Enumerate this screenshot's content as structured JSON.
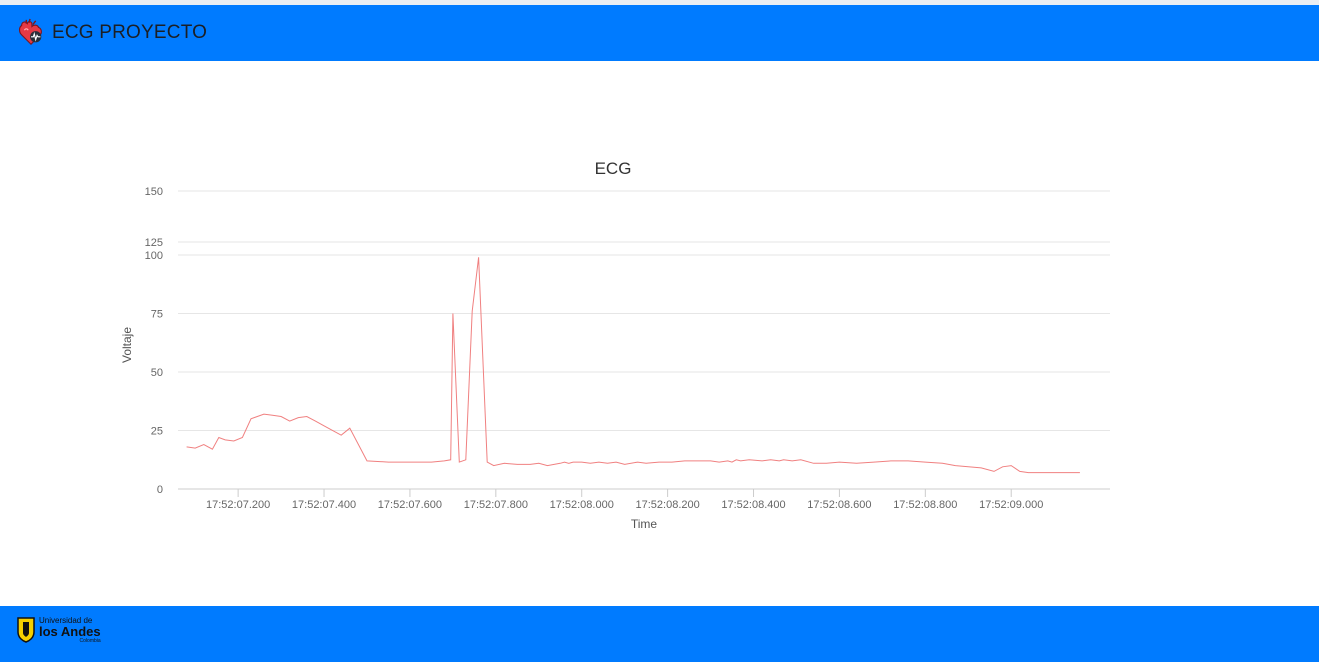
{
  "header": {
    "title": "ECG PROYECTO",
    "brand_icon": "heart-icon",
    "bar_color": "#007bff"
  },
  "footer": {
    "logo": {
      "line1": "Universidad de",
      "line2": "los Andes",
      "line3": "Colombia",
      "icon": "shield-icon"
    }
  },
  "chart_data": {
    "type": "line",
    "title": "ECG",
    "xlabel": "Time",
    "ylabel": "Voltaje",
    "line_color": "#f08080",
    "grid": true,
    "ylim": [
      0,
      150
    ],
    "y_ticks": [
      0,
      25,
      50,
      75,
      100,
      125,
      150
    ],
    "x_ticks": [
      "17:52:07.200",
      "17:52:07.400",
      "17:52:07.600",
      "17:52:07.800",
      "17:52:08.000",
      "17:52:08.200",
      "17:52:08.400",
      "17:52:08.600",
      "17:52:08.800",
      "17:52:09.000"
    ],
    "x_tick_values": [
      7.2,
      7.4,
      7.6,
      7.8,
      8.0,
      8.2,
      8.4,
      8.6,
      8.8,
      9.0
    ],
    "xlim": [
      7.06,
      9.23
    ],
    "series": [
      {
        "x": [
          7.08,
          7.1,
          7.12,
          7.14,
          7.155,
          7.17,
          7.19,
          7.21,
          7.23,
          7.26,
          7.28,
          7.3,
          7.32,
          7.34,
          7.36,
          7.38,
          7.4,
          7.44,
          7.46,
          7.5,
          7.55,
          7.6,
          7.65,
          7.68,
          7.695,
          7.7,
          7.715,
          7.73,
          7.745,
          7.76,
          7.78,
          7.795,
          7.82,
          7.85,
          7.88,
          7.9,
          7.92,
          7.95,
          7.96,
          7.97,
          7.98,
          8.0,
          8.02,
          8.04,
          8.06,
          8.08,
          8.1,
          8.13,
          8.15,
          8.18,
          8.21,
          8.24,
          8.27,
          8.3,
          8.32,
          8.34,
          8.35,
          8.36,
          8.37,
          8.39,
          8.42,
          8.44,
          8.46,
          8.47,
          8.49,
          8.51,
          8.54,
          8.57,
          8.6,
          8.64,
          8.68,
          8.72,
          8.76,
          8.8,
          8.84,
          8.87,
          8.9,
          8.93,
          8.96,
          8.98,
          9.0,
          9.02,
          9.04,
          9.06,
          9.08,
          9.1,
          9.12,
          9.14,
          9.16
        ],
        "y": [
          18,
          17.5,
          19,
          17,
          22,
          21,
          20.5,
          22,
          30,
          32,
          31.5,
          31,
          29,
          30.5,
          31,
          29,
          27,
          23,
          26,
          12,
          11.5,
          11.5,
          11.5,
          12,
          12.5,
          75,
          11.5,
          12.5,
          76,
          99,
          11.5,
          10,
          11,
          10.5,
          10.5,
          11,
          10,
          11,
          11.5,
          11,
          11.5,
          11.5,
          11,
          11.5,
          11,
          11.5,
          10.5,
          11.5,
          11,
          11.5,
          11.5,
          12,
          12,
          12,
          11.5,
          12,
          11.5,
          12.5,
          12,
          12.5,
          12,
          12.5,
          12,
          12.5,
          12,
          12.5,
          11,
          11,
          11.5,
          11,
          11.5,
          12,
          12,
          11.5,
          11,
          10,
          9.5,
          9,
          7.5,
          9.5,
          10,
          7.5,
          7,
          7,
          7,
          7,
          7,
          7,
          7
        ]
      }
    ]
  }
}
